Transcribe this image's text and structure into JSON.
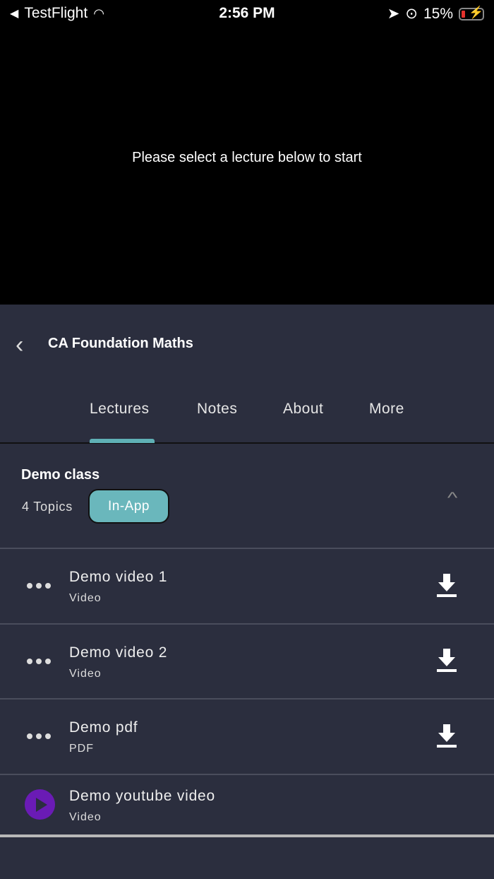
{
  "status_bar": {
    "back_app": "TestFlight",
    "time": "2:56 PM",
    "battery": "15%"
  },
  "player": {
    "message": "Please select a lecture below to start"
  },
  "header": {
    "title": "CA Foundation Maths"
  },
  "tabs": [
    {
      "label": "Lectures",
      "active": true
    },
    {
      "label": "Notes"
    },
    {
      "label": "About"
    },
    {
      "label": "More"
    }
  ],
  "section": {
    "title": "Demo class",
    "topics": "4 Topics",
    "badge": "In-App"
  },
  "lectures": [
    {
      "name": "Demo video 1",
      "type": "Video",
      "icon": "more-dots-icon",
      "action": "download-icon"
    },
    {
      "name": "Demo video 2",
      "type": "Video",
      "icon": "more-dots-icon",
      "action": "download-icon"
    },
    {
      "name": "Demo pdf",
      "type": "PDF",
      "icon": "more-dots-icon",
      "action": "download-icon"
    },
    {
      "name": "Demo youtube video",
      "type": "Video",
      "icon": "play-icon"
    }
  ],
  "colors": {
    "background": "#2b2e3e",
    "accent": "#6ab7bc",
    "play": "#6a1bb5"
  }
}
